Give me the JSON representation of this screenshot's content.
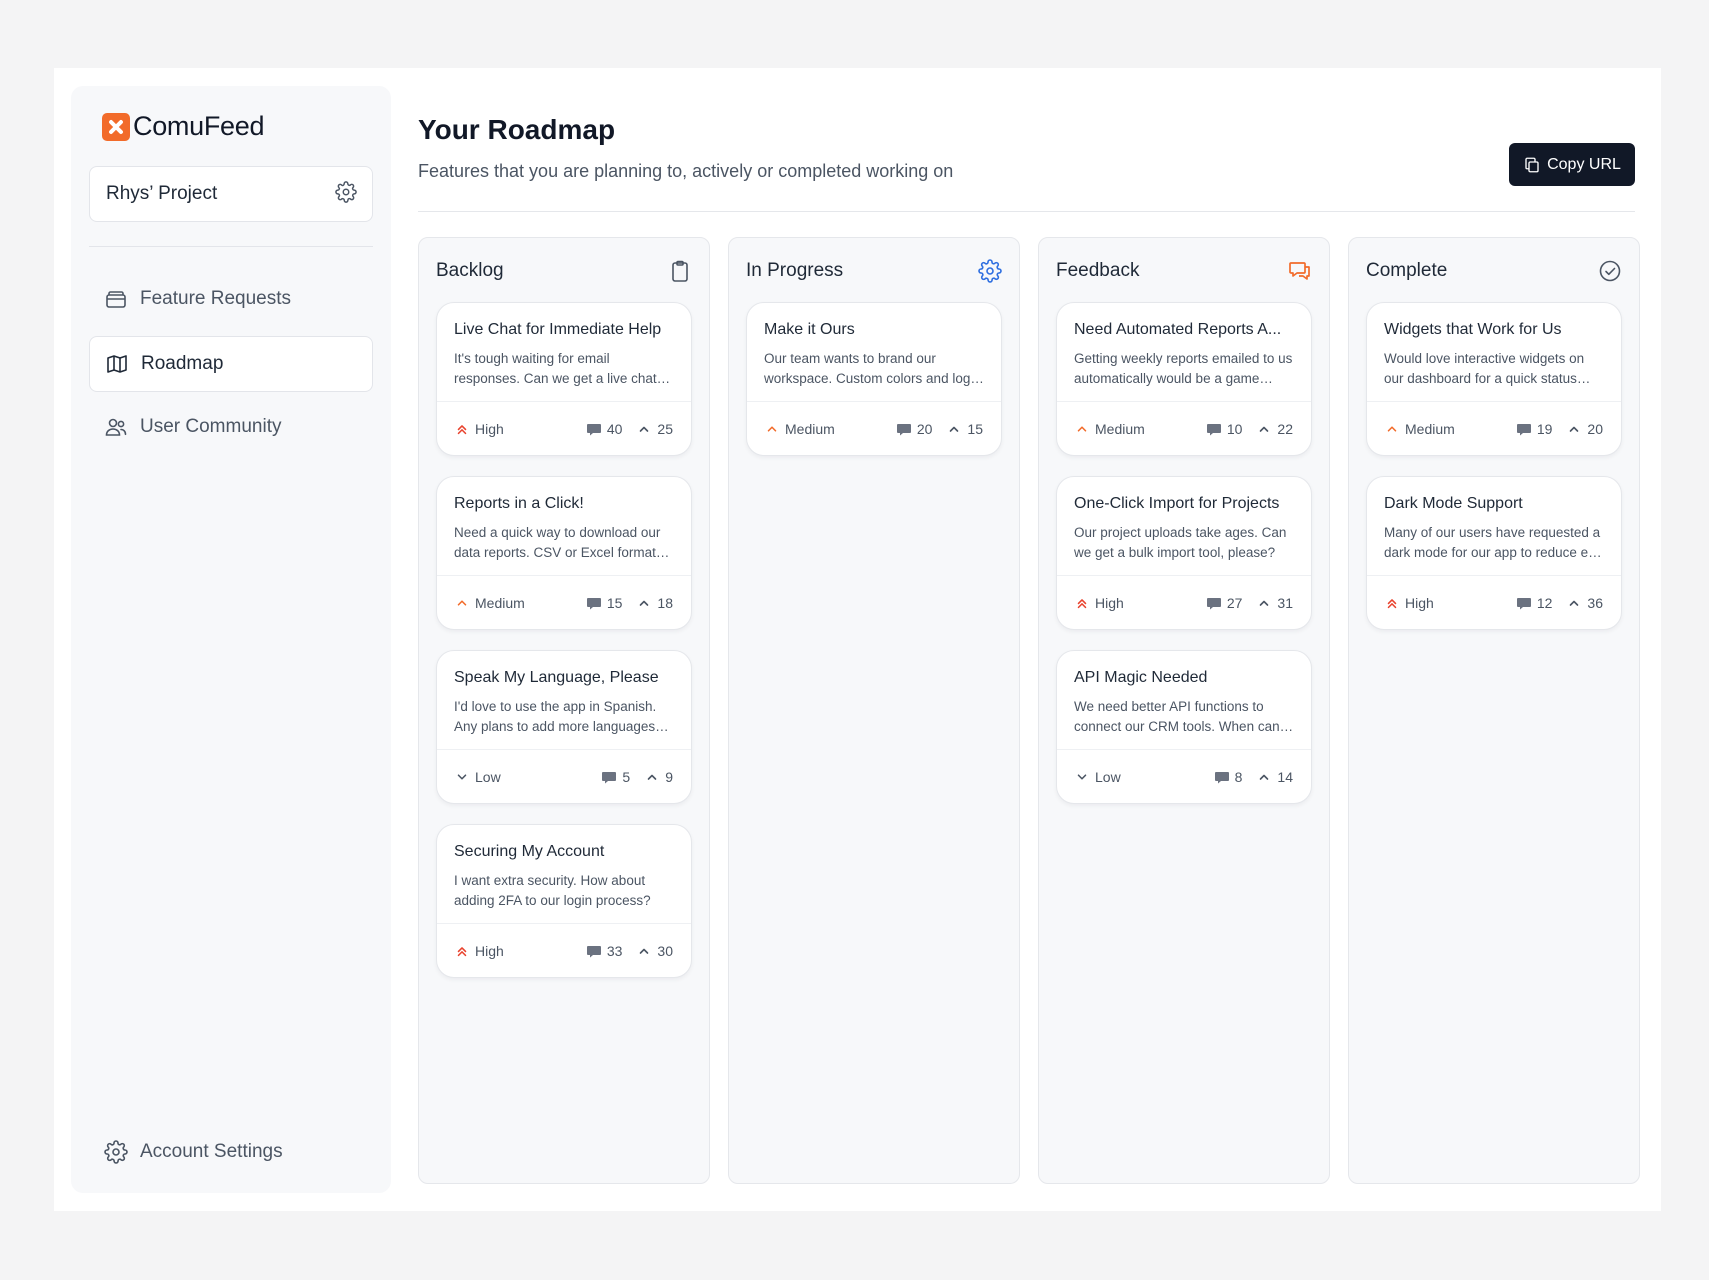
{
  "app": {
    "name": "ComuFeed",
    "brand_color": "#f26b2a"
  },
  "project": {
    "name": "Rhys’ Project"
  },
  "sidebar": {
    "items": [
      {
        "label": "Feature Requests",
        "icon": "inbox-icon"
      },
      {
        "label": "Roadmap",
        "icon": "map-icon",
        "active": true
      },
      {
        "label": "User Community",
        "icon": "users-icon"
      }
    ],
    "footer": {
      "label": "Account Settings",
      "icon": "gear-icon"
    }
  },
  "header": {
    "title": "Your Roadmap",
    "subtitle": "Features that you are planning to, actively or completed working on",
    "copy_label": "Copy URL"
  },
  "columns": [
    {
      "title": "Backlog",
      "icon": "clipboard-icon",
      "cards": [
        {
          "title": "Live Chat for Immediate Help",
          "desc": "It's tough waiting for email responses. Can we get a live chat option?",
          "priority": "High",
          "comments": "40",
          "votes": "25"
        },
        {
          "title": "Reports in a Click!",
          "desc": "Need a quick way to download our data reports. CSV or Excel format please.",
          "priority": "Medium",
          "comments": "15",
          "votes": "18"
        },
        {
          "title": "Speak My Language, Please",
          "desc": "I'd love to use the app in Spanish. Any plans to add more languages soon?",
          "priority": "Low",
          "comments": "5",
          "votes": "9"
        },
        {
          "title": "Securing My Account",
          "desc": "I want extra security. How about adding 2FA to our login process?",
          "priority": "High",
          "comments": "33",
          "votes": "30"
        }
      ]
    },
    {
      "title": "In Progress",
      "icon": "gear-icon",
      "cards": [
        {
          "title": "Make it Ours",
          "desc": "Our team wants to brand our workspace. Custom colors and logos would help.",
          "priority": "Medium",
          "comments": "20",
          "votes": "15"
        }
      ]
    },
    {
      "title": "Feedback",
      "icon": "chat-icon",
      "cards": [
        {
          "title": "Need Automated Reports A...",
          "desc": "Getting weekly reports emailed to us automatically would be a game changer.",
          "priority": "Medium",
          "comments": "10",
          "votes": "22"
        },
        {
          "title": "One-Click Import for Projects",
          "desc": "Our project uploads take ages. Can we get a bulk import tool, please?",
          "priority": "High",
          "comments": "27",
          "votes": "31"
        },
        {
          "title": "API Magic Needed",
          "desc": "We need better API functions to connect our CRM tools. When can we expect it?",
          "priority": "Low",
          "comments": "8",
          "votes": "14"
        }
      ]
    },
    {
      "title": "Complete",
      "icon": "check-circle-icon",
      "cards": [
        {
          "title": "Widgets that Work for Us",
          "desc": "Would love interactive widgets on our dashboard for a quick status overview.",
          "priority": "Medium",
          "comments": "19",
          "votes": "20"
        },
        {
          "title": "Dark Mode Support",
          "desc": "Many of our users have requested a dark mode for our app to reduce eye strain.",
          "priority": "High",
          "comments": "12",
          "votes": "36"
        }
      ]
    }
  ],
  "colors": {
    "high": "#e8432e",
    "medium": "#f26b2a",
    "low": "#4b5563",
    "progress_icon": "#2f6fe0",
    "feedback_icon": "#f26b2a"
  }
}
